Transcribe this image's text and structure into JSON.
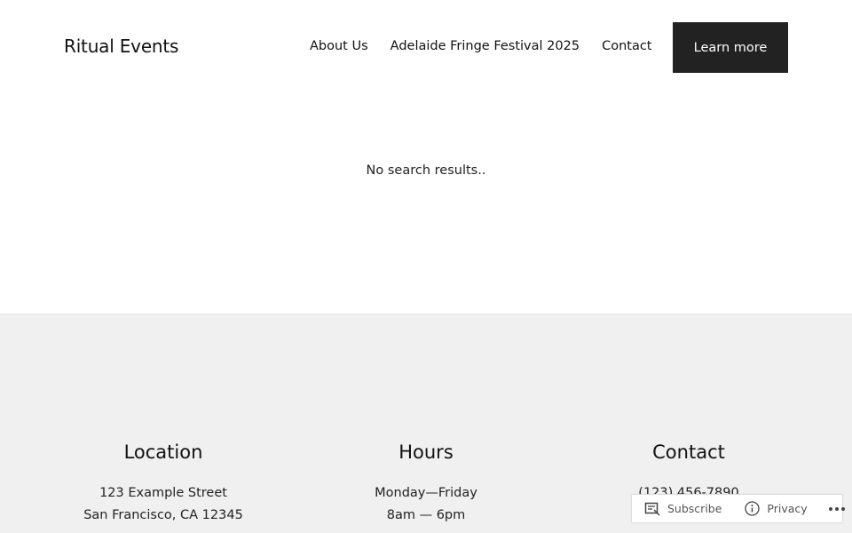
{
  "header": {
    "site_title": "Ritual Events",
    "nav": [
      "About Us",
      "Adelaide Fringe Festival 2025",
      "Contact"
    ],
    "cta_label": "Learn more"
  },
  "main": {
    "message": "No search results.."
  },
  "footer": {
    "location": {
      "heading": "Location",
      "line1": "123 Example Street",
      "line2": "San Francisco, CA 12345"
    },
    "hours": {
      "heading": "Hours",
      "line1": "Monday—Friday",
      "line2": "8am — 6pm"
    },
    "contact": {
      "heading": "Contact",
      "line1": "(123) 456-7890"
    }
  },
  "wpbar": {
    "subscribe_label": "Subscribe",
    "privacy_label": "Privacy",
    "icons": [
      "reader-icon",
      "info-icon",
      "more-icon"
    ]
  },
  "colors": {
    "cta_bg": "#222222",
    "footer_bg": "#f0f0f0"
  }
}
